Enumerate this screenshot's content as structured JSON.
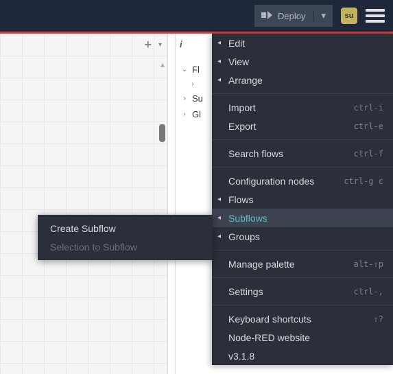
{
  "header": {
    "deploy_label": "Deploy",
    "avatar_text": "su"
  },
  "sidepanel": {
    "info_prefix": "i",
    "info_label": "i",
    "tree": {
      "flows_label": "Fl",
      "sub_label": "Su",
      "global_label": "Gl"
    }
  },
  "menu": {
    "edit": "Edit",
    "view": "View",
    "arrange": "Arrange",
    "import": "Import",
    "import_sc": "ctrl-i",
    "export": "Export",
    "export_sc": "ctrl-e",
    "search_flows": "Search flows",
    "search_sc": "ctrl-f",
    "config_nodes": "Configuration nodes",
    "config_sc": "ctrl-g c",
    "flows": "Flows",
    "subflows": "Subflows",
    "groups": "Groups",
    "manage_palette": "Manage palette",
    "manage_sc": "alt-⇧p",
    "settings": "Settings",
    "settings_sc": "ctrl-,",
    "keyboard": "Keyboard shortcuts",
    "keyboard_sc": "⇧?",
    "website": "Node-RED website",
    "version": "v3.1.8"
  },
  "submenu": {
    "create": "Create Subflow",
    "selection": "Selection to Subflow"
  }
}
